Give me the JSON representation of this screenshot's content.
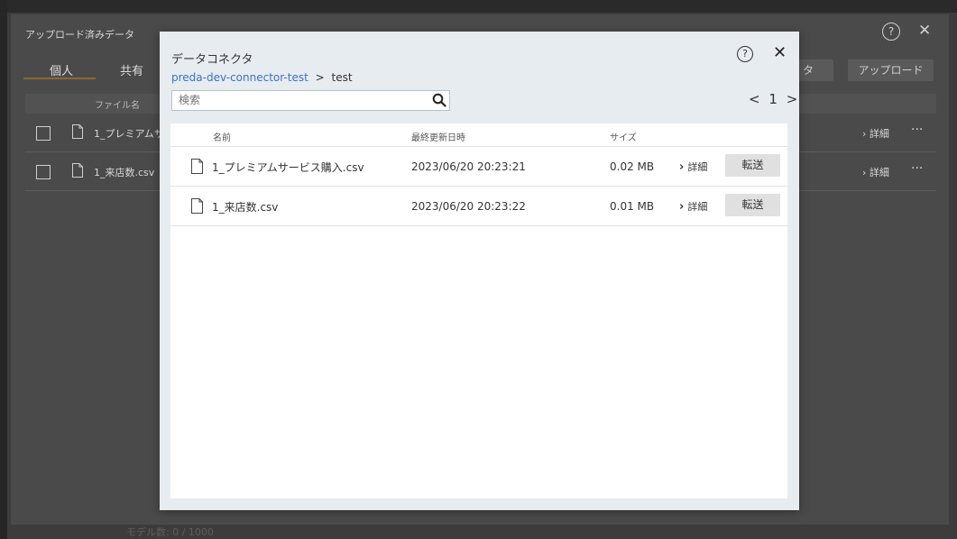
{
  "background": {
    "panel_title": "アップロード済みデータ",
    "tabs": [
      "個人",
      "共有"
    ],
    "help_icon": "?",
    "close_icon": "✕",
    "buttons": [
      "タ",
      "アップロード"
    ],
    "column_header": "ファイル名",
    "rows": [
      {
        "name": "1_プレミアムサ"
      },
      {
        "name": "1_来店数.csv"
      }
    ],
    "detail_label": "詳細",
    "more_label": "···",
    "footer": "モデル数: 0 / 1000"
  },
  "modal": {
    "title": "データコネクタ",
    "breadcrumb": {
      "root": "preda-dev-connector-test",
      "separator": ">",
      "current": "test"
    },
    "help_icon": "?",
    "close_icon": "✕",
    "search": {
      "placeholder": "検索",
      "value": ""
    },
    "pager": {
      "prev": "<",
      "page": "1",
      "next": ">"
    },
    "columns": {
      "name": "名前",
      "modified": "最終更新日時",
      "size": "サイズ"
    },
    "files": [
      {
        "name": "1_プレミアムサービス購入.csv",
        "modified": "2023/06/20 20:23:21",
        "size": "0.02 MB",
        "detail": "詳細",
        "transfer": "転送"
      },
      {
        "name": "1_来店数.csv",
        "modified": "2023/06/20 20:23:22",
        "size": "0.01 MB",
        "detail": "詳細",
        "transfer": "転送"
      }
    ]
  },
  "colors": {
    "link": "#3a72c8",
    "modal_bg": "#e7ecf0",
    "overlay": "#3c3c3c",
    "tab_accent": "#8a6a30"
  }
}
